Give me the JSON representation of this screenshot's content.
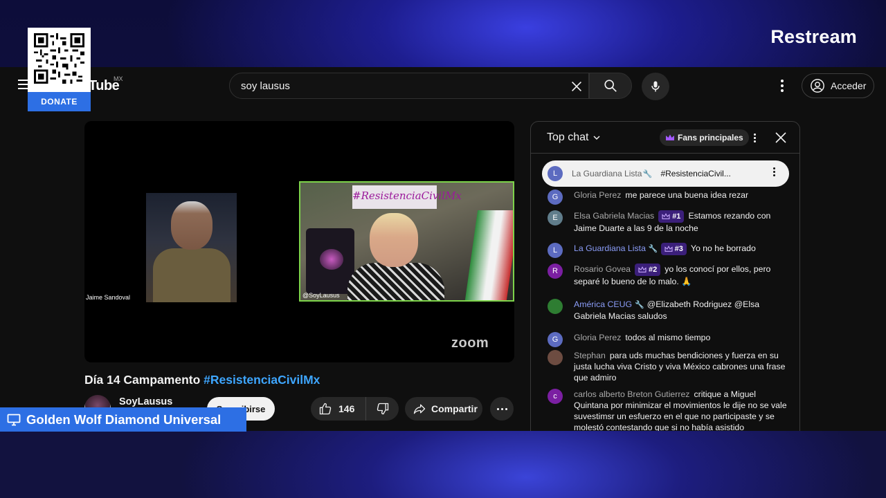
{
  "brand": "Restream",
  "overlay": {
    "donate_label": "DONATE",
    "banner_text": "Golden Wolf Diamond Universal"
  },
  "header": {
    "logo_text": "Tube",
    "country": "MX",
    "search_value": "soy lausus",
    "signin_label": "Acceder"
  },
  "video": {
    "left_participant": "Jaime Sandoval",
    "right_participant": "@SoyLausus",
    "banner_text": "#ResistenciaCivilMx",
    "zoom_logo": "zoom",
    "title_prefix": "Día 14 Campamento ",
    "title_tag": "#ResistenciaCivilMx",
    "channel": "SoyLausus",
    "subscribe_label": "Suscribirse",
    "likes": "146",
    "share_label": "Compartir"
  },
  "chat": {
    "mode_label": "Top chat",
    "fans_label": "Fans principales",
    "pinned": {
      "initial": "L",
      "author": "La Guardiana Lista",
      "message": "#ResistenciaCivil..."
    },
    "messages": [
      {
        "initial": "G",
        "color": "#5c6bc0",
        "author": "Gloria Perez",
        "text": "me parece una buena idea rezar"
      },
      {
        "initial": "E",
        "color": "#607d8b",
        "author": "Elsa Gabriela Macias",
        "rank": "#1",
        "text": "Estamos rezando con Jaime Duarte a las 9 de la noche"
      },
      {
        "initial": "L",
        "color": "#5c6bc0",
        "author": "La Guardiana Lista",
        "rank": "#3",
        "text": "Yo no he borrado"
      },
      {
        "initial": "R",
        "color": "#7b1fa2",
        "author": "Rosario Govea",
        "rank": "#2",
        "text": "yo los conocí por ellos, pero separé lo bueno de lo malo. 🙏"
      },
      {
        "initial": "",
        "color": "#2e7d32",
        "author": "América CEUG",
        "text": "@Elizabeth Rodriguez @Elsa Gabriela Macias saludos"
      },
      {
        "initial": "G",
        "color": "#5c6bc0",
        "author": "Gloria Perez",
        "text": "todos al mismo tiempo"
      },
      {
        "initial": "",
        "color": "#6d4c41",
        "author": "Stephan",
        "text": "para uds muchas bendiciones y fuerza en su justa lucha viva Cristo y viva México cabrones una frase que admiro"
      },
      {
        "initial": "c",
        "color": "#7b1fa2",
        "author": "carlos alberto Breton Gutierrez",
        "text": "critique a Miguel Quintana por minimizar el movimientos le dije no se vale suvestimsr un esfuerzo en el que no participaste y se molestó contestando que si no había asistido"
      }
    ]
  }
}
